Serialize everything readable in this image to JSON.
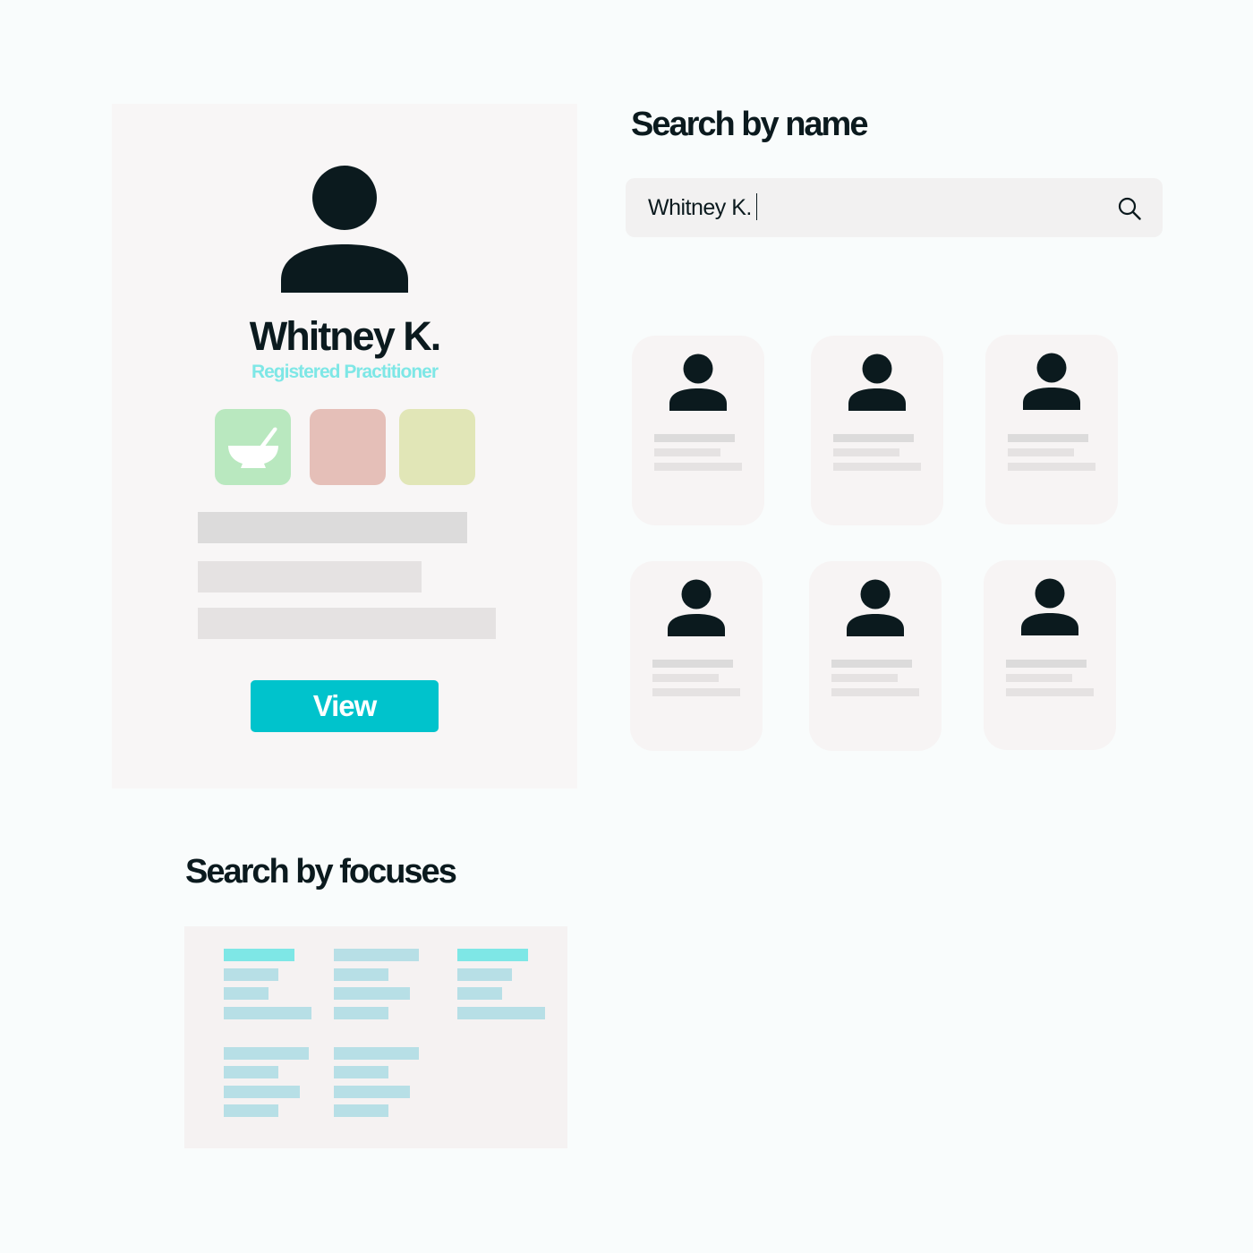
{
  "profile": {
    "name": "Whitney K.",
    "role": "Registered Practitioner",
    "focus_tiles": [
      {
        "color": "#b9e8bf",
        "icon": "mortar-pestle-icon"
      },
      {
        "color": "#e5bfb8",
        "icon": ""
      },
      {
        "color": "#e1e6b7",
        "icon": ""
      }
    ],
    "view_label": "View"
  },
  "name_search": {
    "heading": "Search by name",
    "value": "Whitney K."
  },
  "results": {
    "count": 6
  },
  "focus_search": {
    "heading": "Search by focuses",
    "highlight_color": "#7ee7e6",
    "option_color": "#b7dfe6"
  },
  "colors": {
    "accent": "#00c3cc",
    "text": "#0b1a1e",
    "role": "#7ee7e6"
  }
}
